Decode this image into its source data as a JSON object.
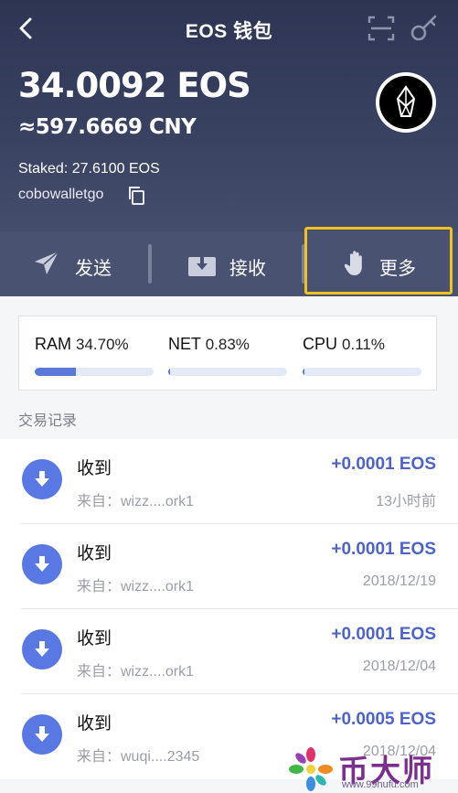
{
  "header": {
    "title": "EOS 钱包",
    "balance": "34.0092 EOS",
    "cny": "≈597.6669 CNY",
    "staked": "Staked: 27.6100 EOS",
    "account": "cobowalletgo"
  },
  "actions": {
    "send": "发送",
    "receive": "接收",
    "more": "更多"
  },
  "resources": [
    {
      "name": "RAM",
      "value": "34.70%",
      "fill": 0.347
    },
    {
      "name": "NET",
      "value": "0.83%",
      "fill": 0.0083
    },
    {
      "name": "CPU",
      "value": "0.11%",
      "fill": 0.0011
    }
  ],
  "section_title": "交易记录",
  "transactions": [
    {
      "type": "收到",
      "from": "来自：wizz....ork1",
      "amount": "+0.0001 EOS",
      "time": "13小时前"
    },
    {
      "type": "收到",
      "from": "来自：wizz....ork1",
      "amount": "+0.0001 EOS",
      "time": "2018/12/19"
    },
    {
      "type": "收到",
      "from": "来自：wizz....ork1",
      "amount": "+0.0001 EOS",
      "time": "2018/12/04"
    },
    {
      "type": "收到",
      "from": "来自：wuqi....2345",
      "amount": "+0.0005 EOS",
      "time": "2018/12/04"
    }
  ],
  "watermark": {
    "brand": "币大师",
    "url": "www.99hufu.com"
  },
  "colors": {
    "accent": "#4d63c8",
    "highlight": "#f1c21b",
    "header": "#2e3553"
  }
}
